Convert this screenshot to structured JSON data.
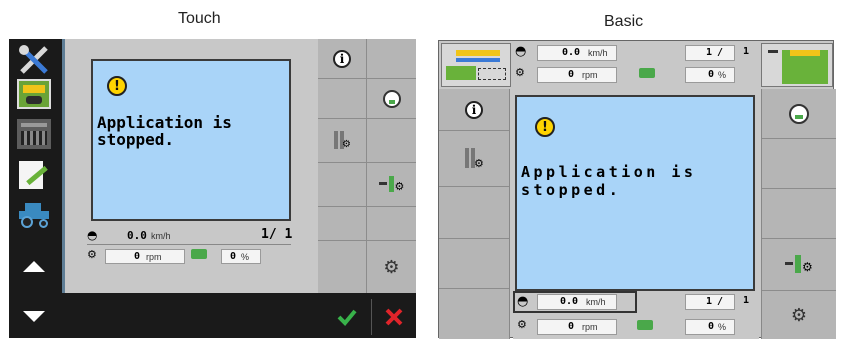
{
  "captions": {
    "touch": "Touch",
    "basic": "Basic"
  },
  "message": {
    "line1": "Application is",
    "line2": "stopped."
  },
  "warning_symbol": "!",
  "status": {
    "speed_value": "0.0",
    "speed_unit": "km/h",
    "page": "1/ 1",
    "rpm_value": "0",
    "rpm_unit": "rpm",
    "percent_value": "0",
    "percent_unit": "%"
  },
  "basic_status": {
    "speed_value": "0.0",
    "speed_unit": "km/h",
    "page_num": "1",
    "page_total": "1",
    "rpm_value": "0",
    "rpm_unit": "rpm",
    "percent_value": "0",
    "percent_unit": "%"
  },
  "colors": {
    "screen_blue": "#a9d4f8",
    "panel_gray": "#c8c8c8",
    "softkey_gray": "#b5b5b5",
    "dark": "#1a1a1a",
    "confirm_green": "#38b24a",
    "cancel_red": "#e0242a"
  }
}
